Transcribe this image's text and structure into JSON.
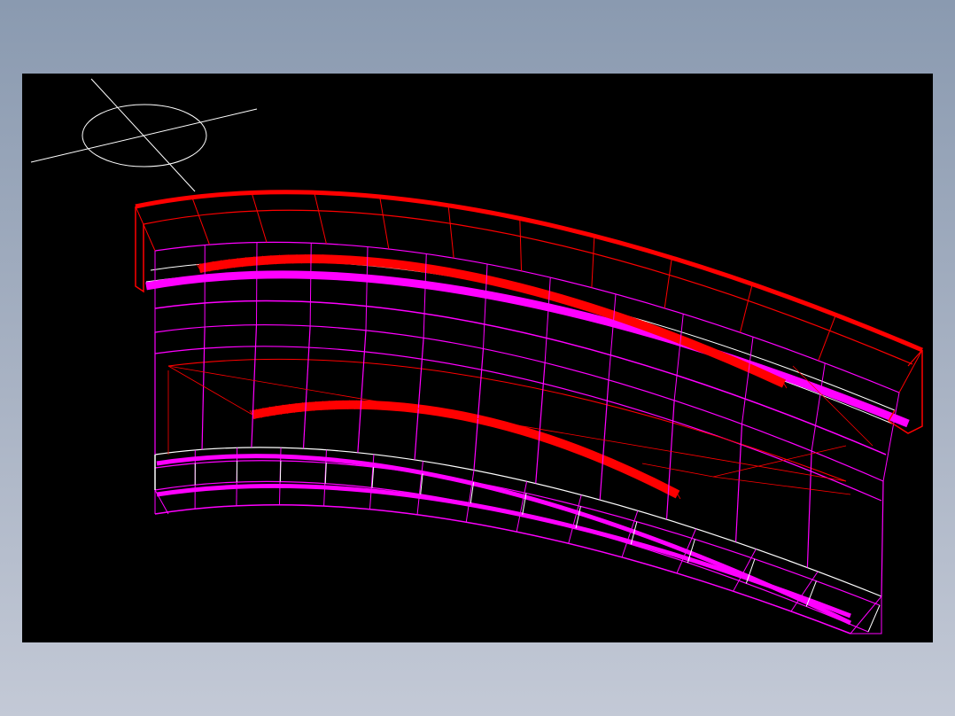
{
  "colors": {
    "frame_top": "#8a9ab0",
    "frame_bottom": "#c3c9d6",
    "viewport_bg": "#000000",
    "red": "#ff0000",
    "magenta": "#ff00ff",
    "white": "#ffffff"
  },
  "icons": {
    "view_cube": "ucs-ellipse-crosshair-icon"
  }
}
